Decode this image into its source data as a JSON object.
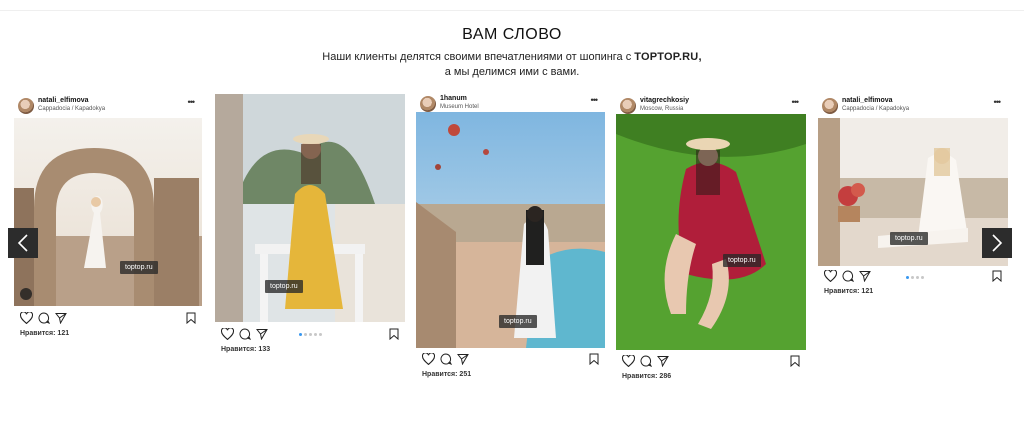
{
  "section": {
    "title": "ВАМ СЛОВО",
    "subtitle_line1": "Наши клиенты делятся своими впечатлениями от шопинга с",
    "subtitle_brand": "TOPTOP.RU,",
    "subtitle_line2": "а мы делимся ими с вами."
  },
  "posts": [
    {
      "username": "natali_elfimova",
      "location": "Cappadocia / Kapadokya",
      "watermark": "toptop.ru",
      "likes": "Нравится: 121"
    },
    {
      "username": "",
      "location": "",
      "watermark": "toptop.ru",
      "likes": "Нравится: 133"
    },
    {
      "username": "1hanum",
      "location": "Museum Hotel",
      "watermark": "toptop.ru",
      "likes": "Нравится: 251"
    },
    {
      "username": "vitagrechkosiy",
      "location": "Moscow, Russia",
      "watermark": "toptop.ru",
      "likes": "Нравится: 286"
    },
    {
      "username": "natali_elfimova",
      "location": "Cappadocia / Kapadokya",
      "watermark": "toptop.ru",
      "likes": "Нравится: 121"
    }
  ],
  "nav": {
    "prev_icon": "chevron-left-icon",
    "next_icon": "chevron-right-icon"
  },
  "colors": {
    "background": "#ffffff",
    "nav_button": "#2c2c2c",
    "pager_active": "#3897f0",
    "pager_inactive": "#c8c8c8"
  }
}
